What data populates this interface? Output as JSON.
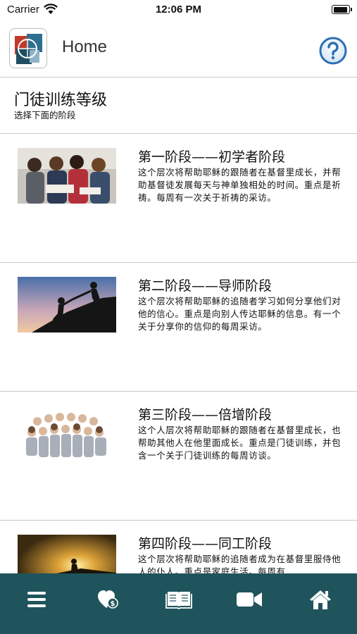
{
  "status_bar": {
    "carrier": "Carrier",
    "time": "12:06 PM"
  },
  "navbar": {
    "title": "Home",
    "help_icon": "question-circle-icon",
    "logo_icon": "app-logo-icon"
  },
  "header": {
    "title": "门徒训练等级",
    "subtitle": "选择下面的阶段"
  },
  "levels": [
    {
      "title": "第一阶段——初学者阶段",
      "description": "这个层次将帮助耶稣的跟随者在基督里成长，并帮助基督徒发展每天与神单独相处的时间。重点是祈祷。每周有一次关于祈祷的采访。",
      "image": "group-bible-study-photo"
    },
    {
      "title": "第二阶段——导师阶段",
      "description": "这个层次将帮助耶稣的追随者学习如何分享他们对他的信心。重点是向别人传达耶稣的信息。有一个关于分享你的信仰的每周采访。",
      "image": "helping-hand-climb-photo"
    },
    {
      "title": "第三阶段——倍增阶段",
      "description": "这个人层次将帮助耶稣的跟随者在基督里成长，也帮助其他人在他里面成长。重点是门徒训练，并包含一个关于门徒训练的每周访谈。",
      "image": "crowd-of-people-photo"
    },
    {
      "title": "第四阶段——同工阶段",
      "description": "这个层次将帮助耶稣的追随者成为在基督里服侍他人的仆人。重点是家庭生活。每周有",
      "image": "sunset-climb-photo"
    }
  ],
  "tabbar": {
    "colors": {
      "background": "#1f545c",
      "icon": "#ffffff"
    },
    "items": [
      {
        "icon": "menu-icon"
      },
      {
        "icon": "heart-donate-icon"
      },
      {
        "icon": "book-icon"
      },
      {
        "icon": "video-camera-icon"
      },
      {
        "icon": "home-icon"
      }
    ]
  }
}
